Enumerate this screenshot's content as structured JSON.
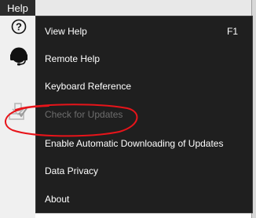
{
  "menubar": {
    "help_label": "Help"
  },
  "sidebar_icons": [
    "help-circle-icon",
    "headset-icon",
    "update-check-icon"
  ],
  "help_menu": {
    "items": [
      {
        "label": "View Help",
        "shortcut": "F1",
        "enabled": true
      },
      {
        "label": "Remote Help",
        "enabled": true
      },
      {
        "label": "Keyboard Reference",
        "enabled": true
      },
      {
        "label": "Check for Updates",
        "enabled": false
      },
      {
        "label": "Enable Automatic Downloading of Updates",
        "enabled": true
      },
      {
        "label": "Data Privacy",
        "enabled": true
      },
      {
        "label": "About",
        "enabled": true
      }
    ]
  },
  "colors": {
    "menu_background": "#1f1f1f",
    "menu_text": "#ffffff",
    "disabled_text": "#6d6d6d",
    "annotation": "#e8141a"
  }
}
